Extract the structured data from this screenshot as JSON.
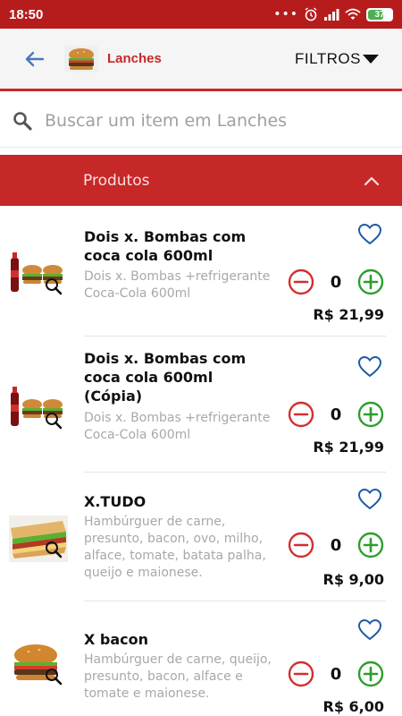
{
  "status_bar": {
    "time": "18:50",
    "dots": "•••",
    "battery": "37"
  },
  "app_bar": {
    "category_title": "Lanches",
    "filters_label": "FILTROS"
  },
  "search": {
    "placeholder": "Buscar um item em Lanches"
  },
  "section": {
    "title": "Produtos"
  },
  "products": [
    {
      "name": "Dois x. Bombas com coca cola 600ml",
      "description": "Dois x. Bombas +refrigerante Coca-Cola 600ml",
      "quantity": "0",
      "price": "R$ 21,99",
      "thumb": "combo-cola-burgers"
    },
    {
      "name": "Dois x. Bombas com coca cola 600ml (Cópia)",
      "description": "Dois x. Bombas +refrigerante Coca-Cola 600ml",
      "quantity": "0",
      "price": "R$ 21,99",
      "thumb": "combo-cola-burgers"
    },
    {
      "name": "X.TUDO",
      "description": "Hambúrguer de carne, presunto, bacon, ovo, milho, alface, tomate, batata palha, queijo e maionese.",
      "quantity": "0",
      "price": "R$ 9,00",
      "thumb": "sandwich"
    },
    {
      "name": "X bacon",
      "description": "Hambúrguer de carne, queijo, presunto, bacon, alface e tomate e maionese.",
      "quantity": "0",
      "price": "R$ 6,00",
      "thumb": "burger"
    }
  ],
  "colors": {
    "brand_red": "#c62828",
    "minus_red": "#d32f2f",
    "plus_green": "#2e9e2e",
    "heart_blue": "#1e5aa8"
  }
}
